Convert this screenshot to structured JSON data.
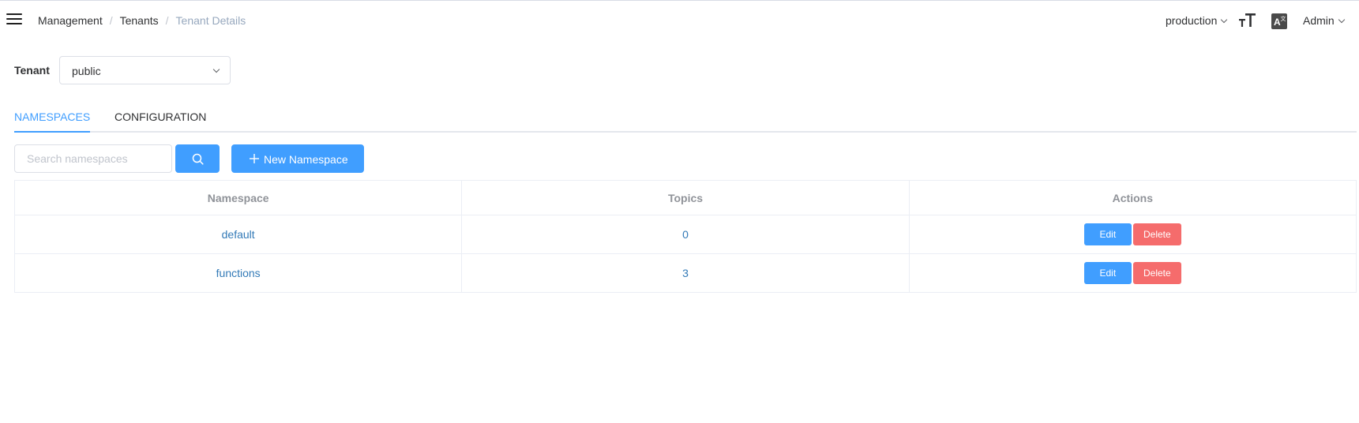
{
  "navbar": {
    "breadcrumb": [
      "Management",
      "Tenants",
      "Tenant Details"
    ],
    "environment": "production",
    "user": "Admin"
  },
  "tenant": {
    "label": "Tenant",
    "selected": "public"
  },
  "tabs": [
    {
      "label": "NAMESPACES",
      "active": true
    },
    {
      "label": "CONFIGURATION",
      "active": false
    }
  ],
  "toolbar": {
    "search_placeholder": "Search namespaces",
    "new_button_label": "New Namespace"
  },
  "table": {
    "headers": [
      "Namespace",
      "Topics",
      "Actions"
    ],
    "rows": [
      {
        "namespace": "default",
        "topics": "0"
      },
      {
        "namespace": "functions",
        "topics": "3"
      }
    ],
    "edit_label": "Edit",
    "delete_label": "Delete"
  },
  "colors": {
    "primary": "#409eff",
    "danger": "#f56c6c",
    "link": "#337ab7"
  }
}
